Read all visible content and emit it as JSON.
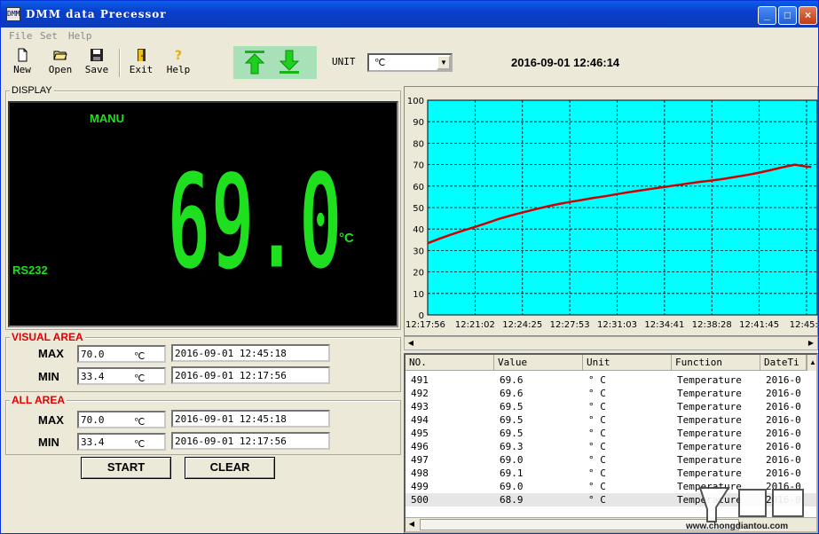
{
  "window": {
    "title": "DMM data Precessor",
    "icon_text": "DMM"
  },
  "menu": [
    "File",
    "Set",
    "Help"
  ],
  "toolbar": {
    "buttons": [
      {
        "label": "New",
        "icon": "new-file-icon"
      },
      {
        "label": "Open",
        "icon": "open-folder-icon"
      },
      {
        "label": "Save",
        "icon": "floppy-icon"
      },
      {
        "label": "Exit",
        "icon": "door-exit-icon"
      },
      {
        "label": "Help",
        "icon": "question-icon"
      }
    ],
    "unit_label": "UNIT",
    "unit_value": "℃",
    "datetime": "2016-09-01 12:46:14"
  },
  "display": {
    "group_label": "DISPLAY",
    "mode": "MANU",
    "interface": "RS232",
    "reading": "69.0",
    "unit": "°C"
  },
  "visual_area": {
    "label": "VISUAL AREA",
    "max_label": "MAX",
    "max_value": "70.0",
    "max_unit": "℃",
    "max_time": "2016-09-01 12:45:18",
    "min_label": "MIN",
    "min_value": "33.4",
    "min_unit": "℃",
    "min_time": "2016-09-01 12:17:56"
  },
  "all_area": {
    "label": "ALL AREA",
    "max_label": "MAX",
    "max_value": "70.0",
    "max_unit": "℃",
    "max_time": "2016-09-01 12:45:18",
    "min_label": "MIN",
    "min_value": "33.4",
    "min_unit": "℃",
    "min_time": "2016-09-01 12:17:56"
  },
  "buttons": {
    "start": "START",
    "clear": "CLEAR"
  },
  "chart_data": {
    "type": "line",
    "ylim": [
      0,
      100
    ],
    "yticks": [
      "100",
      "90",
      "80",
      "70",
      "60",
      "50",
      "40",
      "30",
      "20",
      "10",
      "0"
    ],
    "xticks": [
      "12:17:56",
      "12:21:02",
      "12:24:25",
      "12:27:53",
      "12:31:03",
      "12:34:41",
      "12:38:28",
      "12:41:45",
      "12:45:2"
    ],
    "background": "#00ffff",
    "line_color": "#d00000",
    "grid": true,
    "series": [
      {
        "x": [
          0,
          0.25,
          0.5,
          0.75,
          1,
          1.25,
          1.5,
          1.75,
          2,
          2.25,
          2.5,
          2.75,
          3,
          3.25,
          3.5,
          3.75,
          4,
          4.25,
          4.5,
          4.75,
          5,
          5.25,
          5.5,
          5.75,
          6,
          6.25,
          6.5,
          6.75,
          7,
          7.25,
          7.5,
          7.75,
          8,
          8.1
        ],
        "values": [
          33.4,
          35.5,
          37.5,
          39.3,
          41.0,
          42.8,
          44.7,
          46.3,
          47.7,
          49.1,
          50.4,
          51.6,
          52.6,
          53.5,
          54.5,
          55.3,
          56.3,
          57.2,
          58.0,
          58.8,
          59.6,
          60.4,
          61.2,
          62.0,
          62.6,
          63.4,
          64.3,
          65.2,
          66.3,
          67.5,
          68.8,
          70.0,
          69.1,
          68.9
        ]
      }
    ]
  },
  "table": {
    "columns": [
      "NO.",
      "Value",
      "Unit",
      "Function",
      "DateTi"
    ],
    "rows": [
      [
        "491",
        "69.6",
        "° C",
        "Temperature",
        "2016-0"
      ],
      [
        "492",
        "69.6",
        "° C",
        "Temperature",
        "2016-0"
      ],
      [
        "493",
        "69.5",
        "° C",
        "Temperature",
        "2016-0"
      ],
      [
        "494",
        "69.5",
        "° C",
        "Temperature",
        "2016-0"
      ],
      [
        "495",
        "69.5",
        "° C",
        "Temperature",
        "2016-0"
      ],
      [
        "496",
        "69.3",
        "° C",
        "Temperature",
        "2016-0"
      ],
      [
        "497",
        "69.0",
        "° C",
        "Temperature",
        "2016-0"
      ],
      [
        "498",
        "69.1",
        "° C",
        "Temperature",
        "2016-0"
      ],
      [
        "499",
        "69.0",
        "° C",
        "Temperature",
        "2016-0"
      ],
      [
        "500",
        "68.9",
        "° C",
        "Temperature",
        "2016-0"
      ]
    ]
  },
  "watermark": {
    "site": "www.chongdiantou.com"
  }
}
